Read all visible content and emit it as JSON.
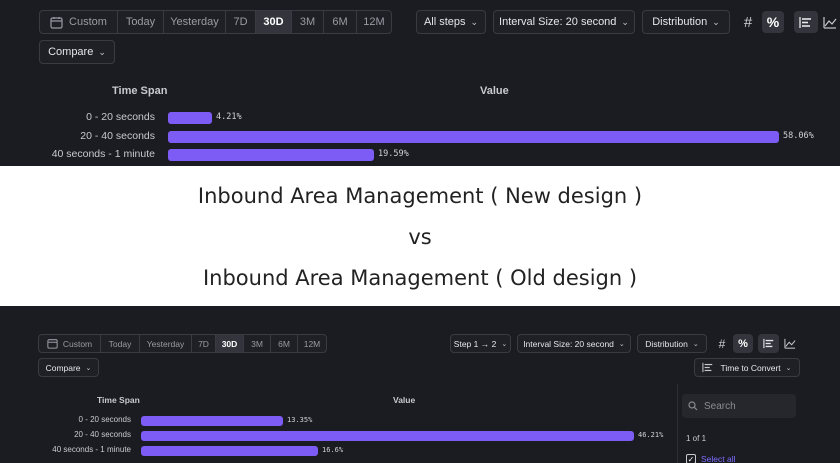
{
  "new_design": {
    "date_tabs": [
      "Custom",
      "Today",
      "Yesterday",
      "7D",
      "30D",
      "3M",
      "6M",
      "12M"
    ],
    "active_tab": "30D",
    "steps_label": "All steps",
    "interval_label": "Interval Size: 20 second",
    "distribution_label": "Distribution",
    "compare_label": "Compare",
    "col_time_span": "Time Span",
    "col_value": "Value",
    "rows": [
      {
        "label": "0 - 20 seconds",
        "value_text": "4.21%",
        "fraction": 0.0421
      },
      {
        "label": "20 - 40 seconds",
        "value_text": "58.06%",
        "fraction": 0.5806
      },
      {
        "label": "40 seconds - 1 minute",
        "value_text": "19.59%",
        "fraction": 0.1959
      }
    ]
  },
  "captions": {
    "line1": "Inbound Area Management ( New design )",
    "line2": "vs",
    "line3": "Inbound Area Management ( Old design )"
  },
  "old_design": {
    "date_tabs": [
      "Custom",
      "Today",
      "Yesterday",
      "7D",
      "30D",
      "3M",
      "6M",
      "12M"
    ],
    "active_tab": "30D",
    "steps_label": "Step 1 → 2",
    "interval_label": "Interval Size: 20 second",
    "distribution_label": "Distribution",
    "compare_label": "Compare",
    "time_to_convert_label": "Time to Convert",
    "col_time_span": "Time Span",
    "col_value": "Value",
    "rows": [
      {
        "label": "0 - 20 seconds",
        "value_text": "13.35%",
        "fraction": 0.1335
      },
      {
        "label": "20 - 40 seconds",
        "value_text": "46.21%",
        "fraction": 0.4621
      },
      {
        "label": "40 seconds - 1 minute",
        "value_text": "16.6%",
        "fraction": 0.166
      }
    ],
    "search_placeholder": "Search",
    "count_text": "1 of 1",
    "select_all_label": "Select all"
  },
  "icons": {
    "calendar": "calendar-icon",
    "hash": "hash-icon",
    "percent": "percent-icon",
    "bar_chart": "bar-chart-icon",
    "line_chart": "line-chart-icon",
    "search": "search-icon"
  },
  "colors": {
    "bar": "#7c5cf4",
    "panel_bg": "#1b1c21",
    "link": "#7c6cff"
  }
}
